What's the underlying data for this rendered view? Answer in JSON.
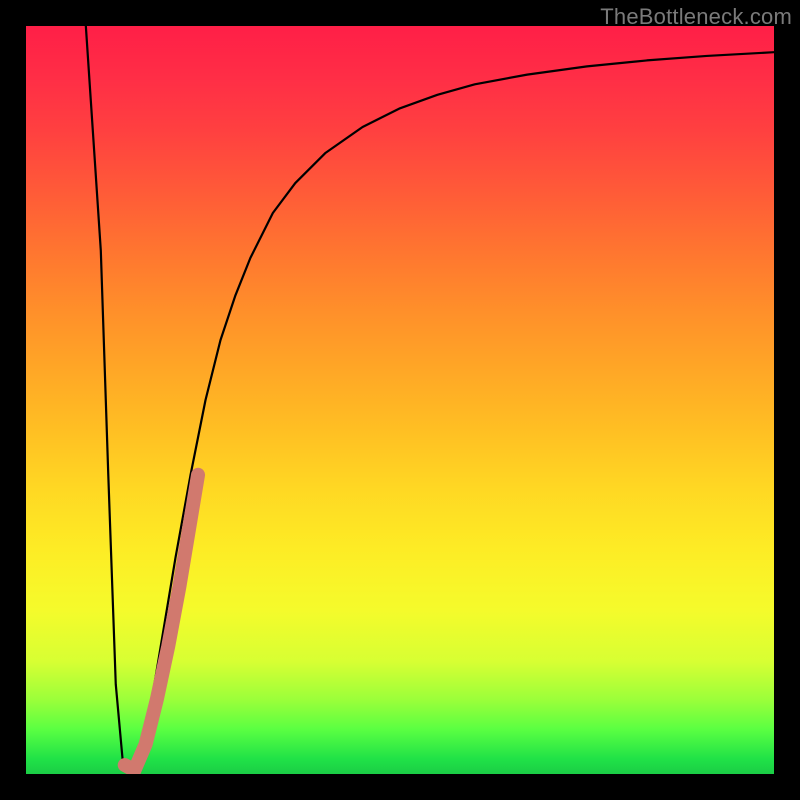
{
  "watermark": "TheBottleneck.com",
  "colors": {
    "frame": "#000000",
    "curve_stroke": "#000000",
    "marker_stroke": "#d1796e",
    "gradient_top": "#ff1f47",
    "gradient_bottom": "#1bcd46"
  },
  "chart_data": {
    "type": "line",
    "title": "",
    "xlabel": "",
    "ylabel": "",
    "xlim": [
      0,
      100
    ],
    "ylim": [
      0,
      100
    ],
    "series": [
      {
        "name": "bottleneck-curve",
        "x": [
          8,
          10,
          11,
          12,
          13,
          14,
          15,
          16,
          17,
          18,
          20,
          22,
          24,
          26,
          28,
          30,
          33,
          36,
          40,
          45,
          50,
          55,
          60,
          67,
          75,
          83,
          91,
          100
        ],
        "values": [
          100,
          70,
          40,
          12,
          1,
          0,
          2,
          6,
          11,
          17,
          29,
          40,
          50,
          58,
          64,
          69,
          75,
          79,
          83,
          86.5,
          89,
          90.8,
          92.2,
          93.5,
          94.6,
          95.4,
          96,
          96.5
        ]
      },
      {
        "name": "highlight-segment",
        "x": [
          13.2,
          14.5,
          16,
          17.5,
          19,
          20.5,
          22,
          23
        ],
        "values": [
          1.2,
          0.5,
          4,
          10,
          17,
          25,
          34,
          40
        ]
      }
    ]
  }
}
